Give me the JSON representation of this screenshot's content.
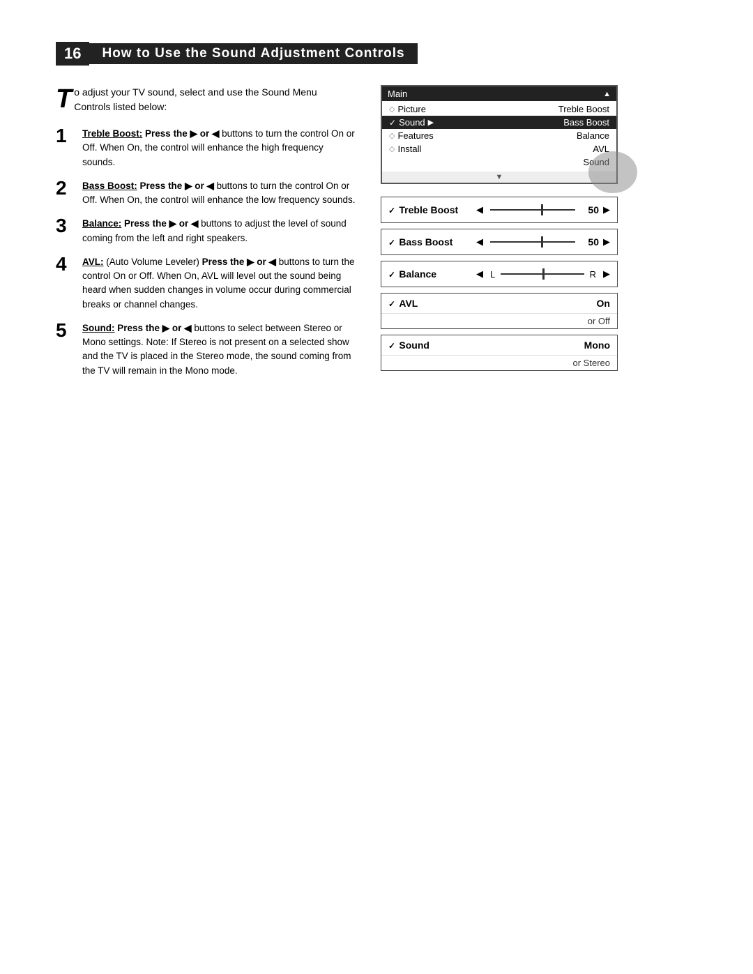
{
  "header": {
    "number": "16",
    "title": "How to Use the Sound Adjustment Controls"
  },
  "intro": {
    "drop_cap": "T",
    "text": "o adjust your TV sound, select and use the Sound Menu Controls listed below:"
  },
  "steps": [
    {
      "number": "1",
      "label": "Treble Boost:",
      "bold_part": "Press the ▶ or ◀",
      "text": " buttons to turn the control On or Off. When On, the control will enhance the high frequency sounds."
    },
    {
      "number": "2",
      "label": "Bass Boost:",
      "bold_part": "Press the ▶ or ◀",
      "text": " buttons to turn the control On or Off. When On, the control will enhance the low frequency sounds."
    },
    {
      "number": "3",
      "label": "Balance:",
      "bold_part": "Press the ▶ or ◀",
      "text": " buttons to adjust the level of sound coming from the left and right speakers."
    },
    {
      "number": "4",
      "label": "AVL:",
      "avl_full": "(Auto Volume Leveler)",
      "bold_part": " Press the ▶ or ◀",
      "text": " buttons to turn the control On or Off. When On, AVL will level out the sound being heard when sudden changes in volume occur during commercial breaks or channel changes."
    },
    {
      "number": "5",
      "label": "Sound:",
      "bold_part": "Press the ▶ or ◀",
      "text": " buttons to select between Stereo or Mono settings. Note: If Stereo is not present on a selected show and the TV is placed in the Stereo mode, the sound coming from the TV will remain in the Mono mode."
    }
  ],
  "menu": {
    "top_label": "Main",
    "top_arrow": "▲",
    "rows": [
      {
        "icon": "◇",
        "left": "Picture",
        "right": "Treble Boost",
        "highlighted": false
      },
      {
        "icon": "✓",
        "left": "Sound",
        "arrow": "▶",
        "right": "Bass Boost",
        "highlighted": true
      },
      {
        "icon": "◇",
        "left": "Features",
        "right": "Balance",
        "highlighted": false
      },
      {
        "icon": "◇",
        "left": "Install",
        "right": "AVL",
        "highlighted": false
      },
      {
        "icon": "",
        "left": "",
        "right": "Sound",
        "highlighted": false
      }
    ],
    "bottom_arrow": "▼"
  },
  "controls": [
    {
      "id": "treble-boost",
      "check": "✓",
      "label": "Treble Boost",
      "left_arrow": "◀",
      "value": "50",
      "right_arrow": "▶",
      "slider_type": "percentage"
    },
    {
      "id": "bass-boost",
      "check": "✓",
      "label": "Bass Boost",
      "left_arrow": "◀",
      "value": "50",
      "right_arrow": "▶",
      "slider_type": "percentage"
    },
    {
      "id": "balance",
      "check": "✓",
      "label": "Balance",
      "left_arrow": "◀",
      "balance_l": "L",
      "balance_r": "R",
      "right_arrow": "▶",
      "slider_type": "balance"
    },
    {
      "id": "avl",
      "check": "✓",
      "label": "AVL",
      "value": "On",
      "or_value": "or Off",
      "double": true
    },
    {
      "id": "sound-mono",
      "check": "✓",
      "label": "Sound",
      "value": "Mono",
      "or_value": "or Stereo",
      "double": true
    }
  ]
}
